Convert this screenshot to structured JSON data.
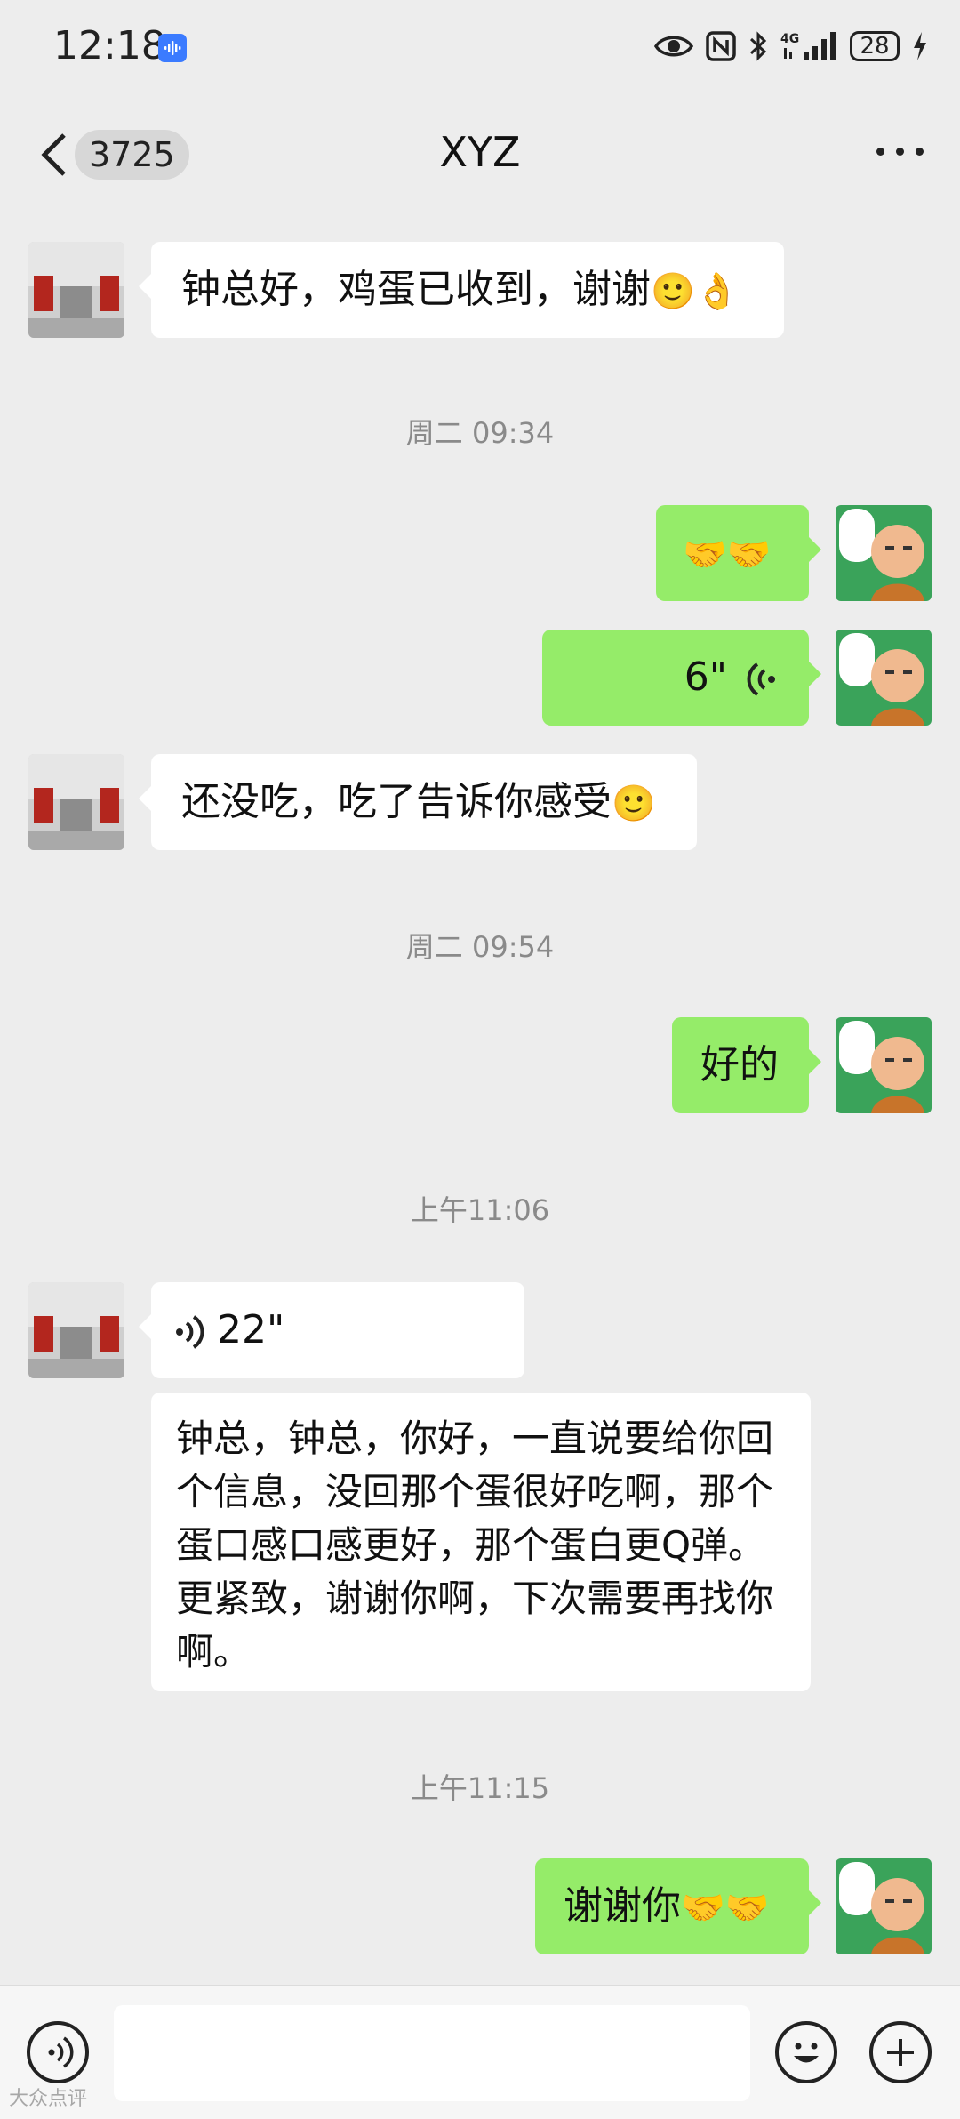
{
  "status_bar": {
    "time": "12:18",
    "battery": "28",
    "icons": [
      "mic-badge-icon",
      "eye-icon",
      "nfc-icon",
      "bluetooth-icon",
      "signal-4g-icon",
      "charging-bolt-icon"
    ]
  },
  "header": {
    "unread_count": "3725",
    "title": "XYZ",
    "more_icon": "more-dots-icon",
    "back_icon": "chevron-left-icon"
  },
  "messages": [
    {
      "side": "in",
      "type": "text",
      "text": "钟总好，鸡蛋已收到，谢谢",
      "emoji": "🙂👌"
    },
    {
      "type": "timestamp",
      "text": "周二 09:34"
    },
    {
      "side": "out",
      "type": "text",
      "text": "",
      "emoji": "🤝🤝"
    },
    {
      "side": "out",
      "type": "voice",
      "duration": "6\""
    },
    {
      "side": "in",
      "type": "text",
      "text": "还没吃，吃了告诉你感受",
      "emoji": "🙂"
    },
    {
      "type": "timestamp",
      "text": "周二 09:54"
    },
    {
      "side": "out",
      "type": "text",
      "text": "好的"
    },
    {
      "type": "timestamp",
      "text": "上午11:06"
    },
    {
      "side": "in",
      "type": "voice",
      "duration": "22\""
    },
    {
      "side": "in",
      "type": "transcript",
      "text": "钟总，钟总，你好，一直说要给你回个信息，没回那个蛋很好吃啊，那个蛋口感口感更好，那个蛋白更Q弹。更紧致，谢谢你啊，下次需要再找你啊。"
    },
    {
      "type": "timestamp",
      "text": "上午11:15"
    },
    {
      "side": "out",
      "type": "text",
      "text": "谢谢你",
      "emoji": "🤝🤝"
    }
  ],
  "input_bar": {
    "voice_icon": "voice-mode-icon",
    "emoji_icon": "emoji-face-icon",
    "plus_icon": "plus-icon",
    "placeholder": ""
  },
  "watermark": "大众点评",
  "colors": {
    "background": "#ededed",
    "outgoing_bubble": "#95ec69",
    "incoming_bubble": "#ffffff",
    "timestamp": "#8a8a8a"
  }
}
